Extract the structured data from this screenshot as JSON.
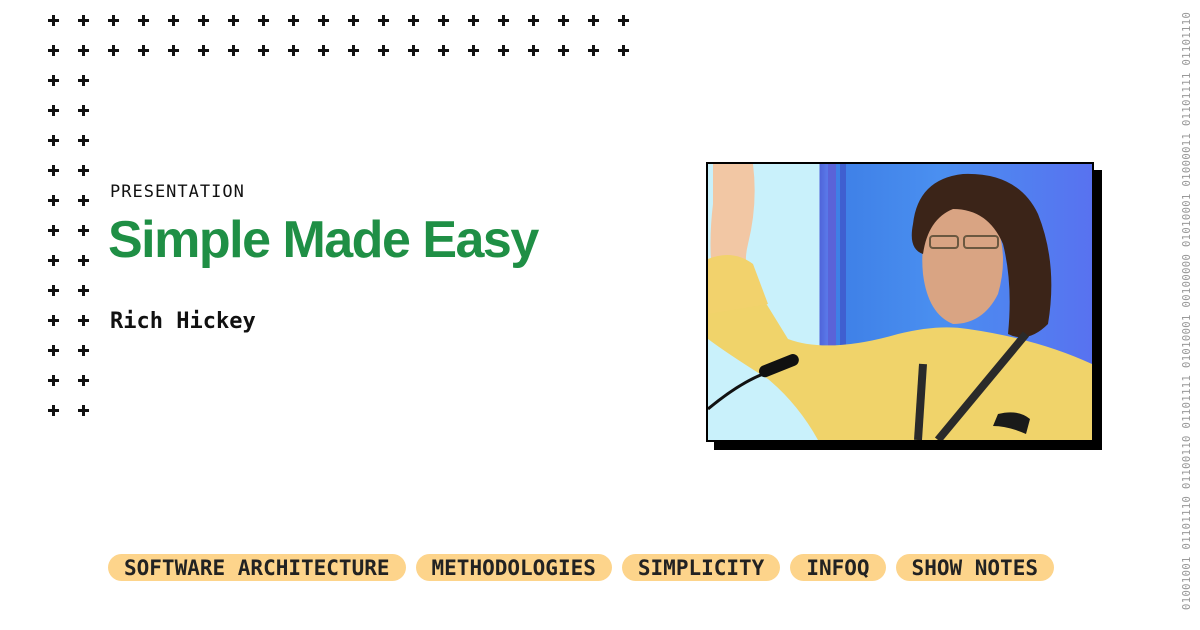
{
  "eyebrow": "PRESENTATION",
  "title": "Simple Made Easy",
  "author": "Rich Hickey",
  "photo": {
    "alt": "Rich Hickey presenting on stage, raising his hand, wearing a yellow shirt and lanyard"
  },
  "tags": [
    "SOFTWARE ARCHITECTURE",
    "METHODOLOGIES",
    "SIMPLICITY",
    "INFOQ",
    "SHOW NOTES"
  ],
  "binary_text": "01001001 01101110 01100110 01101111 01010001 00100000 01010001 01000011 01101111 01101110",
  "colors": {
    "title": "#1f8f45",
    "tag_bg": "#fdd48b",
    "text": "#111111"
  },
  "decor": {
    "plus_icon": "plus-icon"
  }
}
